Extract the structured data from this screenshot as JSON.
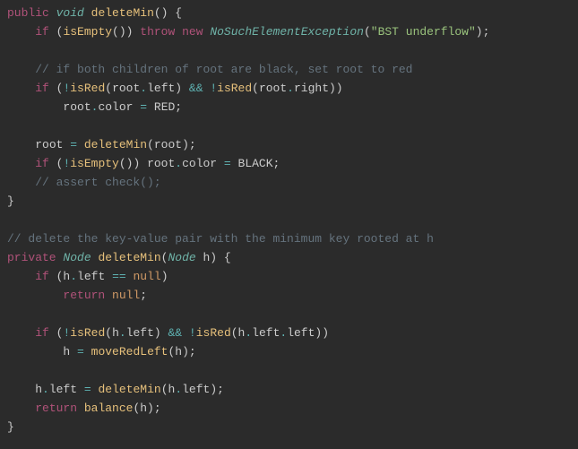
{
  "code": {
    "l1": {
      "kw1": "public",
      "type": "void",
      "fn": "deleteMin",
      "p": "() {"
    },
    "l2": {
      "kw1": "if",
      "p1": " (",
      "fn": "isEmpty",
      "p2": "()) ",
      "kw2": "throw",
      "sp": " ",
      "kw3": "new",
      "sp2": " ",
      "type": "NoSuchElementException",
      "p3": "(",
      "str": "\"BST underflow\"",
      "p4": ");"
    },
    "l3": {
      "cmt": "// if both children of root are black, set root to red"
    },
    "l4": {
      "kw": "if",
      "p1": " (",
      "op1": "!",
      "fn1": "isRed",
      "p2": "(root",
      "dot1": ".",
      "m1": "left) ",
      "op2": "&&",
      "sp": " ",
      "op3": "!",
      "fn2": "isRed",
      "p3": "(root",
      "dot2": ".",
      "m2": "right))"
    },
    "l5": {
      "txt1": "root",
      "dot": ".",
      "m": "color ",
      "op": "=",
      "sp": " ",
      "c": "RED;"
    },
    "l6": {
      "txt1": "root ",
      "op": "=",
      "sp": " ",
      "fn": "deleteMin",
      "p": "(root);"
    },
    "l7": {
      "kw": "if",
      "p1": " (",
      "op1": "!",
      "fn1": "isEmpty",
      "p2": "()) root",
      "dot": ".",
      "m": "color ",
      "op2": "=",
      "sp2": " ",
      "c": "BLACK;"
    },
    "l8": {
      "cmt": "// assert check();"
    },
    "l9": {
      "p": "}"
    },
    "l10": {
      "cmt": "// delete the key-value pair with the minimum key rooted at h"
    },
    "l11": {
      "kw": "private",
      "sp": " ",
      "type1": "Node",
      "sp2": " ",
      "fn": "deleteMin",
      "p1": "(",
      "type2": "Node",
      "p2": " h) {"
    },
    "l12": {
      "kw": "if",
      "p1": " (h",
      "dot": ".",
      "m": "left ",
      "op": "==",
      "sp": " ",
      "null": "null",
      "p2": ")"
    },
    "l13": {
      "kw": "return",
      "sp": " ",
      "null": "null",
      "p": ";"
    },
    "l14": {
      "kw": "if",
      "p1": " (",
      "op1": "!",
      "fn1": "isRed",
      "p2": "(h",
      "dot1": ".",
      "m1": "left) ",
      "op2": "&&",
      "sp": " ",
      "op3": "!",
      "fn2": "isRed",
      "p3": "(h",
      "dot2": ".",
      "m2": "left",
      "dot3": ".",
      "m3": "left))"
    },
    "l15": {
      "txt": "h ",
      "op": "=",
      "sp": " ",
      "fn": "moveRedLeft",
      "p": "(h);"
    },
    "l16": {
      "txt1": "h",
      "dot": ".",
      "m": "left ",
      "op": "=",
      "sp": " ",
      "fn": "deleteMin",
      "p1": "(h",
      "dot2": ".",
      "m2": "left);"
    },
    "l17": {
      "kw": "return",
      "sp": " ",
      "fn": "balance",
      "p": "(h);"
    },
    "l18": {
      "p": "}"
    }
  }
}
